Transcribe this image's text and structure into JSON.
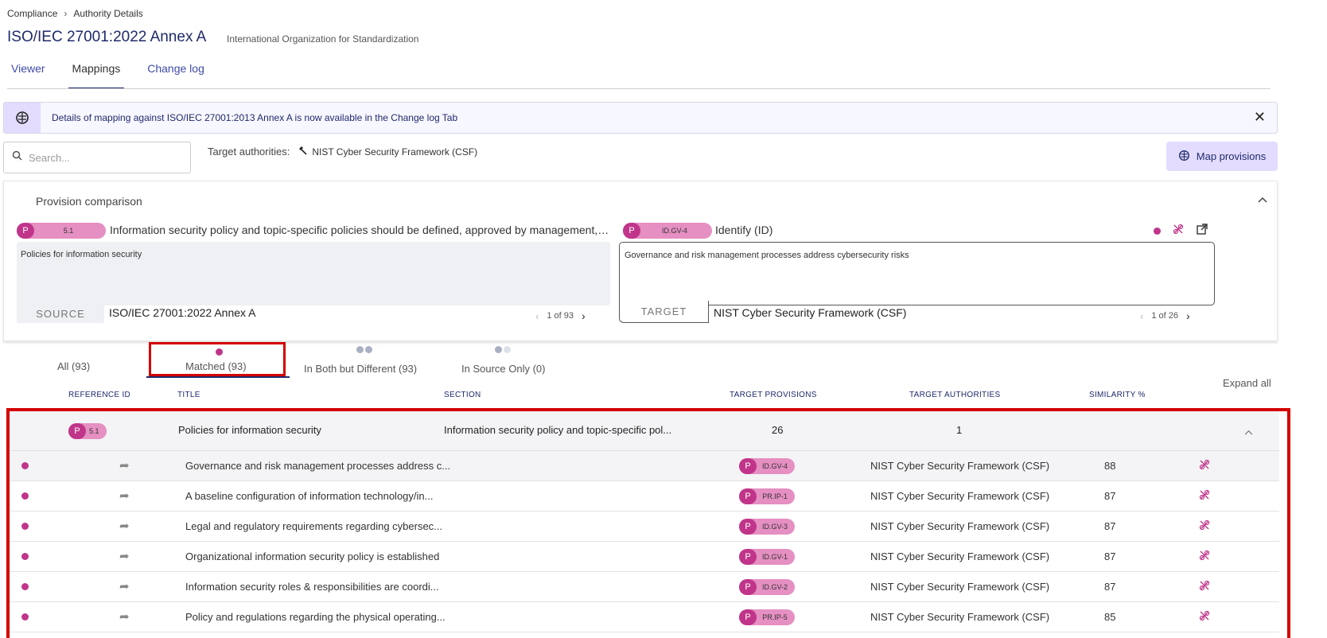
{
  "breadcrumb": {
    "root": "Compliance",
    "current": "Authority Details"
  },
  "header": {
    "title": "ISO/IEC 27001:2022 Annex A",
    "subtitle": "International Organization for Standardization"
  },
  "tabs": [
    {
      "label": "Viewer"
    },
    {
      "label": "Mappings"
    },
    {
      "label": "Change log"
    }
  ],
  "banner": {
    "prefix": "Details of mapping against ",
    "authority": "ISO/IEC 27001:2013 Annex A",
    "middle": " is now available in the ",
    "link": "Change log",
    "suffix": " Tab",
    "close_icon": "close-icon"
  },
  "search": {
    "placeholder": "Search..."
  },
  "target_authorities": {
    "label": "Target authorities:",
    "value": "NIST Cyber Security Framework (CSF)"
  },
  "map_button": {
    "label": "Map provisions"
  },
  "comparison": {
    "title": "Provision comparison",
    "source": {
      "badge": "P",
      "ref": "5.1",
      "heading": "Information security policy and topic-specific policies should be defined, approved by management, published, communicated to and acknowledged by relevant personnel",
      "text": "Policies for information security",
      "label": "SOURCE",
      "authority": "ISO/IEC 27001:2022 Annex A",
      "pager": "1 of 93"
    },
    "target": {
      "badge": "P",
      "ref": "ID.GV-4",
      "heading": "Identify (ID)",
      "text": "Governance and risk management processes address cybersecurity risks",
      "label": "TARGET",
      "authority": "NIST Cyber Security Framework (CSF)",
      "pager": "1 of 26"
    }
  },
  "filter_tabs": [
    {
      "label": "All (93)"
    },
    {
      "label": "Matched (93)"
    },
    {
      "label": "In Both but Different (93)"
    },
    {
      "label": "In Source Only (0)"
    }
  ],
  "expand_all": "Expand all",
  "table": {
    "columns": [
      "REFERENCE ID",
      "TITLE",
      "SECTION",
      "TARGET PROVISIONS",
      "TARGET AUTHORITIES",
      "SIMILARITY %"
    ],
    "group": {
      "badge": "P",
      "ref": "5.1",
      "title": "Policies for information security",
      "section": "Information security policy and topic-specific pol...",
      "target_provisions": "26",
      "target_authorities": "1"
    },
    "rows": [
      {
        "title": "Governance and risk management processes address c...",
        "badge": "P",
        "ref": "ID.GV-4",
        "authority": "NIST Cyber Security Framework (CSF)",
        "similarity": "88"
      },
      {
        "title": "A baseline configuration of information technology/in...",
        "badge": "P",
        "ref": "PR.IP-1",
        "authority": "NIST Cyber Security Framework (CSF)",
        "similarity": "87"
      },
      {
        "title": "Legal and regulatory requirements regarding cybersec...",
        "badge": "P",
        "ref": "ID.GV-3",
        "authority": "NIST Cyber Security Framework (CSF)",
        "similarity": "87"
      },
      {
        "title": "Organizational information security policy is established",
        "badge": "P",
        "ref": "ID.GV-1",
        "authority": "NIST Cyber Security Framework (CSF)",
        "similarity": "87"
      },
      {
        "title": "Information security roles & responsibilities are coordi...",
        "badge": "P",
        "ref": "ID.GV-2",
        "authority": "NIST Cyber Security Framework (CSF)",
        "similarity": "87"
      },
      {
        "title": "Policy and regulations regarding the physical operating...",
        "badge": "P",
        "ref": "PR.IP-5",
        "authority": "NIST Cyber Security Framework (CSF)",
        "similarity": "85"
      }
    ]
  },
  "colors": {
    "accent": "#c0358a",
    "pill": "#e58fc2",
    "primary": "#1f2a6b",
    "highlight": "#d40000",
    "banner_icon_bg": "#e3dcff"
  }
}
